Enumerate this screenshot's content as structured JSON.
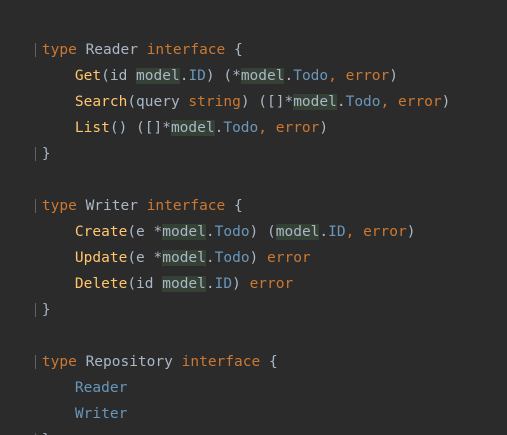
{
  "code": {
    "reader": {
      "kw_type": "type",
      "name": "Reader",
      "kw_interface": "interface",
      "open": "{",
      "get_fn": "Get",
      "get_p1": "(id ",
      "get_pkg1": "model",
      "get_dot1": ".",
      "get_t1": "ID",
      "get_p2": ") (*",
      "get_pkg2": "model",
      "get_dot2": ".",
      "get_t2": "Todo",
      "get_sep": ", ",
      "get_err": "error",
      "get_close": ")",
      "search_fn": "Search",
      "search_p1": "(query ",
      "search_str": "string",
      "search_p2": ") ([]*",
      "search_pkg": "model",
      "search_dot": ".",
      "search_t": "Todo",
      "search_sep": ", ",
      "search_err": "error",
      "search_close": ")",
      "list_fn": "List",
      "list_p1": "() ([]*",
      "list_pkg": "model",
      "list_dot": ".",
      "list_t": "Todo",
      "list_sep": ", ",
      "list_err": "error",
      "list_close": ")",
      "close": "}"
    },
    "writer": {
      "kw_type": "type",
      "name": "Writer",
      "kw_interface": "interface",
      "open": "{",
      "create_fn": "Create",
      "create_p1": "(e *",
      "create_pkg1": "model",
      "create_dot1": ".",
      "create_t1": "Todo",
      "create_p2": ") (",
      "create_pkg2": "model",
      "create_dot2": ".",
      "create_t2": "ID",
      "create_sep": ", ",
      "create_err": "error",
      "create_close": ")",
      "update_fn": "Update",
      "update_p1": "(e *",
      "update_pkg": "model",
      "update_dot": ".",
      "update_t": "Todo",
      "update_p2": ") ",
      "update_err": "error",
      "delete_fn": "Delete",
      "delete_p1": "(id ",
      "delete_pkg": "model",
      "delete_dot": ".",
      "delete_t": "ID",
      "delete_p2": ") ",
      "delete_err": "error",
      "close": "}"
    },
    "repository": {
      "kw_type": "type",
      "name": "Repository",
      "kw_interface": "interface",
      "open": "{",
      "embed1": "Reader",
      "embed2": "Writer",
      "close": "}"
    }
  }
}
